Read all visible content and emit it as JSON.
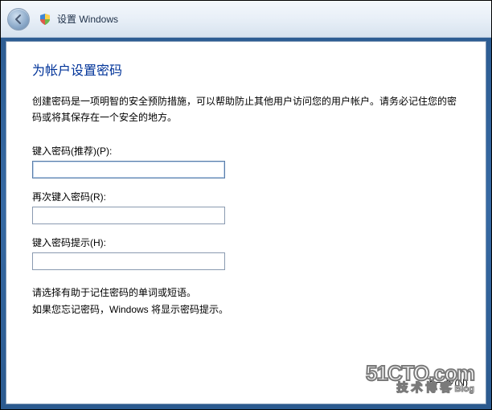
{
  "header": {
    "title": "设置 Windows"
  },
  "page": {
    "heading": "为帐户设置密码",
    "description": "创建密码是一项明智的安全预防措施，可以帮助防止其他用户访问您的用户帐户。请务必记住您的密码或将其保存在一个安全的地方。"
  },
  "fields": {
    "password": {
      "label": "键入密码(推荐)(P):",
      "value": ""
    },
    "confirm": {
      "label": "再次键入密码(R):",
      "value": ""
    },
    "hint": {
      "label": "键入密码提示(H):",
      "value": ""
    }
  },
  "hint_text": {
    "line1": "请选择有助于记住密码的单词或短语。",
    "line2": "如果您忘记密码，Windows 将显示密码提示。"
  },
  "buttons": {
    "next": "下一步(N)"
  },
  "watermark": {
    "line1": "51CTO.com",
    "line2": "技术博客",
    "suffix": "Blog"
  }
}
